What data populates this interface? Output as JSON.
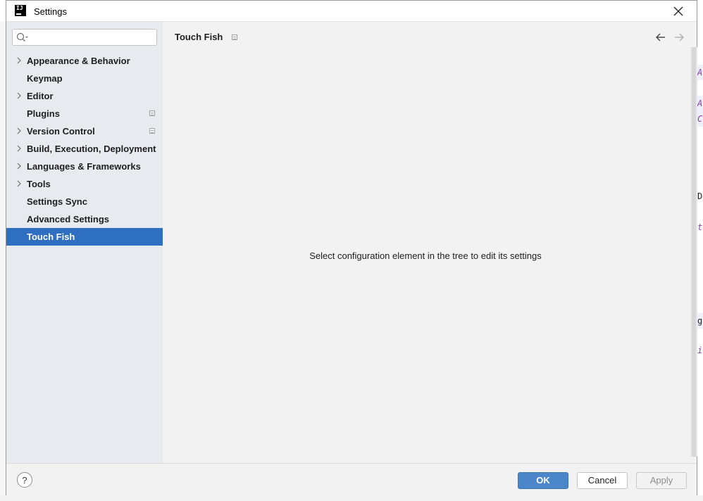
{
  "window": {
    "title": "Settings",
    "app_icon_text": "IJ"
  },
  "search": {
    "value": "",
    "placeholder": ""
  },
  "sidebar": {
    "items": [
      {
        "label": "Appearance & Behavior",
        "expandable": true,
        "project_icon": false
      },
      {
        "label": "Keymap",
        "expandable": false,
        "project_icon": false
      },
      {
        "label": "Editor",
        "expandable": true,
        "project_icon": false
      },
      {
        "label": "Plugins",
        "expandable": false,
        "project_icon": true
      },
      {
        "label": "Version Control",
        "expandable": true,
        "project_icon": true
      },
      {
        "label": "Build, Execution, Deployment",
        "expandable": true,
        "project_icon": false
      },
      {
        "label": "Languages & Frameworks",
        "expandable": true,
        "project_icon": false
      },
      {
        "label": "Tools",
        "expandable": true,
        "project_icon": false
      },
      {
        "label": "Settings Sync",
        "expandable": false,
        "project_icon": false
      },
      {
        "label": "Advanced Settings",
        "expandable": false,
        "project_icon": false
      },
      {
        "label": "Touch Fish",
        "expandable": false,
        "project_icon": false,
        "selected": true
      }
    ]
  },
  "content": {
    "header": "Touch Fish",
    "placeholder": "Select configuration element in the tree to edit its settings"
  },
  "footer": {
    "help_label": "?",
    "ok_label": "OK",
    "cancel_label": "Cancel",
    "apply_label": "Apply"
  },
  "background_code": [
    "A",
    "A",
    "C",
    "D",
    "t",
    "g",
    "i"
  ],
  "colors": {
    "selection": "#2e6fc2",
    "sidebar_bg": "#e7ebef",
    "dialog_bg": "#f2f2f2",
    "ok_button": "#4a86c8"
  }
}
